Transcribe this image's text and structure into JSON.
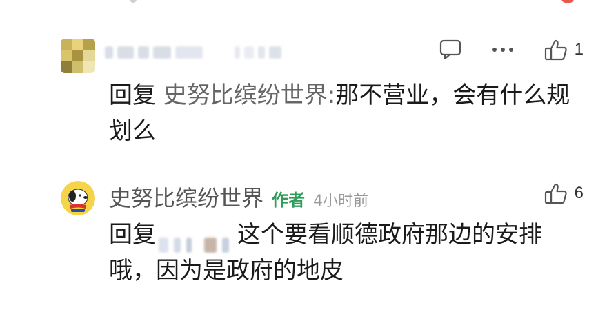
{
  "comments": [
    {
      "reply_prefix": "回复",
      "reply_target": "史努比缤纷世界",
      "reply_colon": ":",
      "body": "那不营业，会有什么规划么",
      "like_count": "1",
      "icons": [
        "comment-icon",
        "more-icon",
        "thumbs-up-icon"
      ]
    },
    {
      "author": "史努比缤纷世界",
      "author_badge": "作者",
      "time": "4小时前",
      "reply_prefix": "回复",
      "body": "这个要看顺德政府那边的安排哦，因为是政府的地皮",
      "like_count": "6",
      "icons": [
        "thumbs-up-icon"
      ]
    }
  ],
  "colors": {
    "badge": "#2f9e5b",
    "muted": "#999999",
    "reply_target": "#666666"
  }
}
